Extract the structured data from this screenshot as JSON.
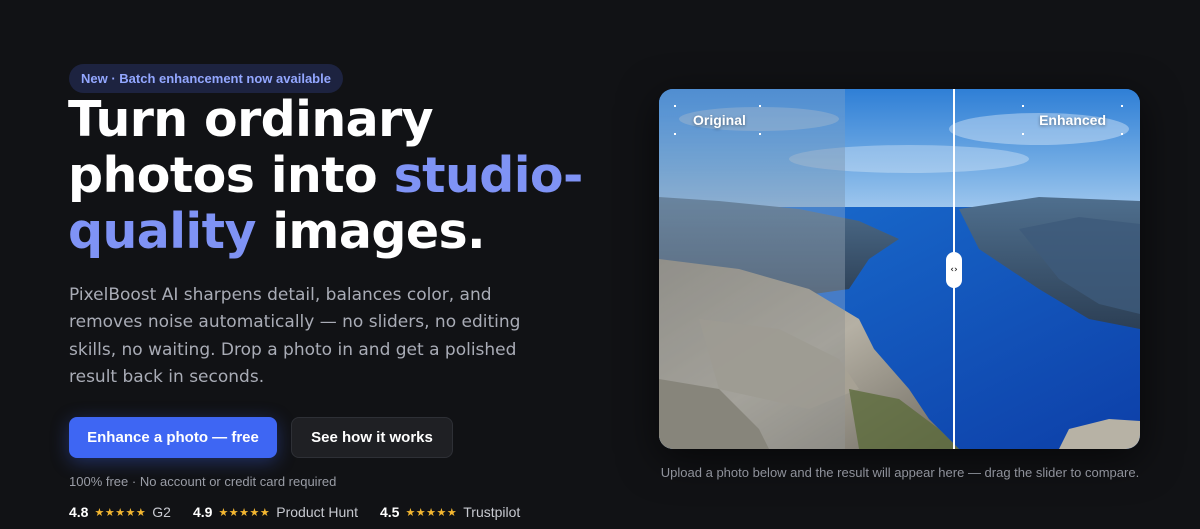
{
  "hero": {
    "badge": "New · Batch enhancement now available",
    "headline_part1": "Turn ordinary photos into ",
    "headline_accent": "studio-quality",
    "headline_part2": " images.",
    "description": "PixelBoost AI sharpens detail, balances color, and removes noise automatically — no sliders, no editing skills, no waiting. Drop a photo in and get a polished result back in seconds.",
    "primary_button": "Enhance a photo — free",
    "secondary_button": "See how it works",
    "fineprint": "100% free · No account or credit card required",
    "ratings": [
      {
        "score": "4.8",
        "stars": "★★★★★",
        "source": "G2"
      },
      {
        "score": "4.9",
        "stars": "★★★★★",
        "source": "Product Hunt"
      },
      {
        "score": "4.5",
        "stars": "★★★★★",
        "source": "Trustpilot"
      }
    ]
  },
  "comparison": {
    "label_original": "Original",
    "label_enhanced": "Enhanced",
    "handle_glyph": "‹›",
    "caption": "Upload a photo below and the result will appear here — drag the slider to compare.",
    "slider_position_fraction": 0.61
  },
  "colors": {
    "background": "#111215",
    "accent": "#7f93f5",
    "primary": "#3e66f3",
    "star": "#f4b731"
  }
}
